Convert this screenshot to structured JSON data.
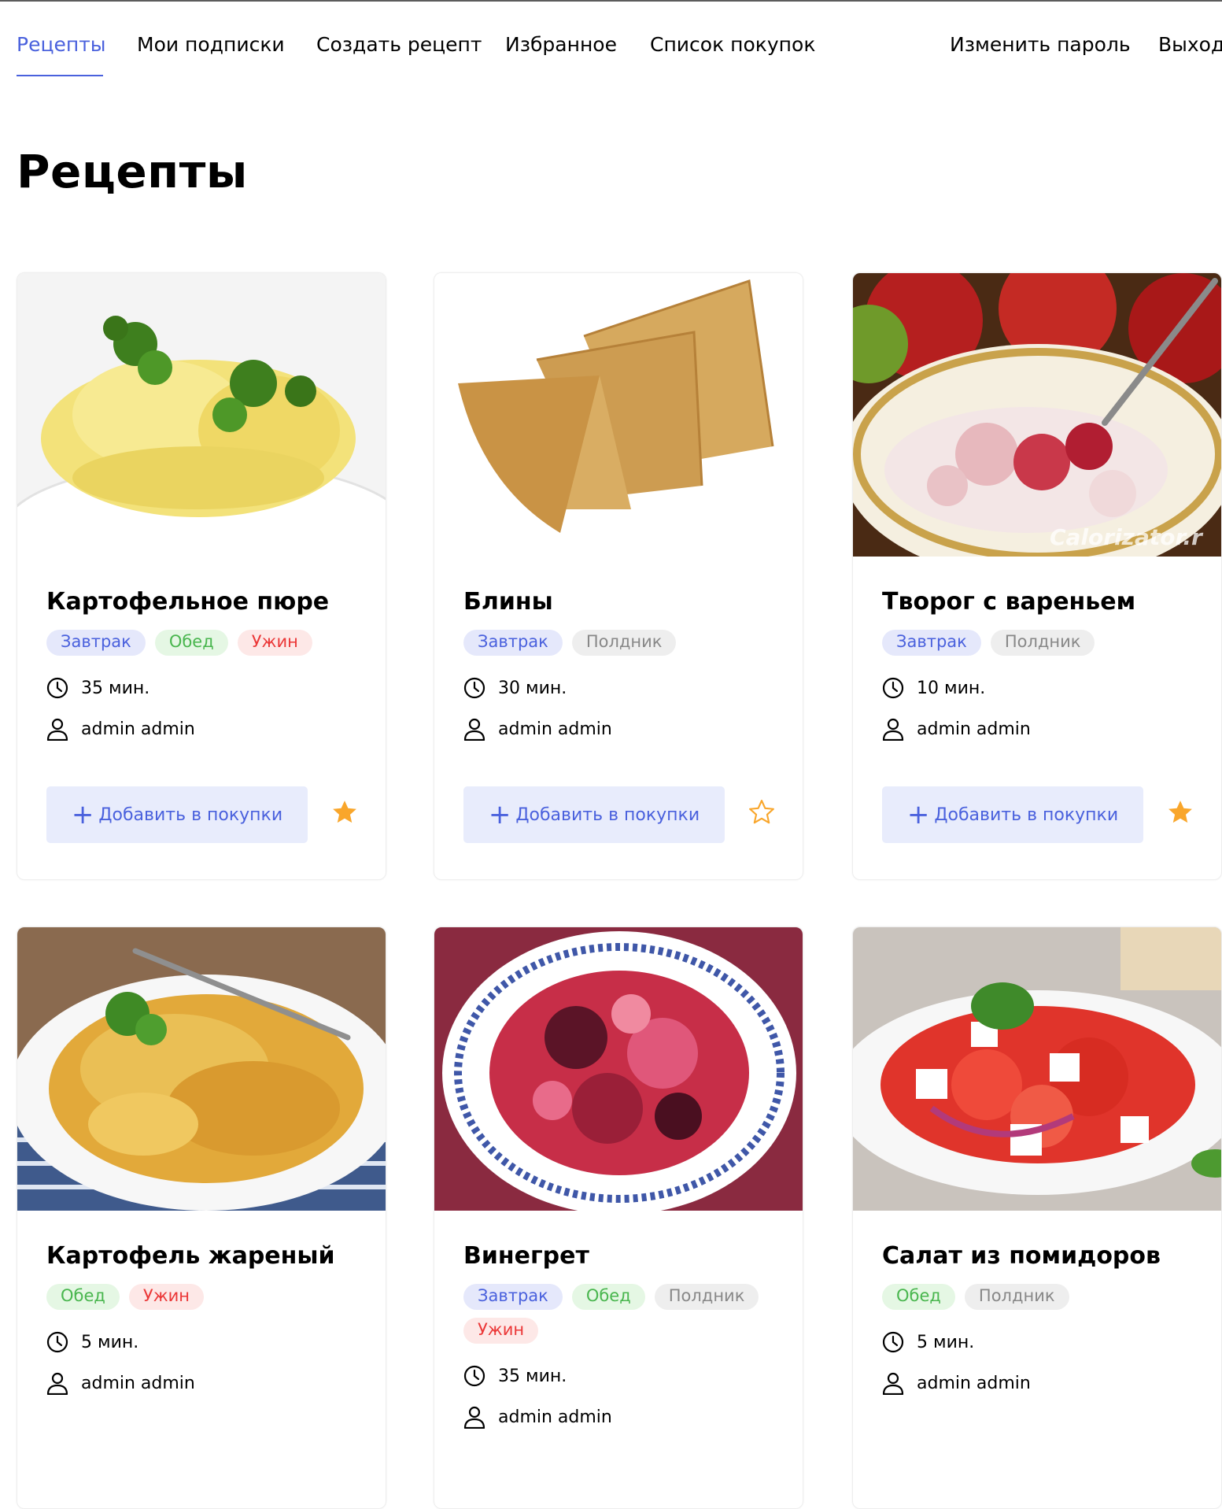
{
  "nav": {
    "links": [
      "Рецепты",
      "Мои подписки",
      "Создать рецепт",
      "Избранное",
      "Список покупок"
    ],
    "right": [
      "Изменить пароль",
      "Выход"
    ],
    "active": "Рецепты"
  },
  "page_title": "Рецепты",
  "colors": {
    "accent": "#4a61dd",
    "star": "#f9a62b"
  },
  "cards": [
    {
      "title": "Картофельное пюре",
      "tags": [
        "Завтрак",
        "Обед",
        "Ужин"
      ],
      "time": "35 мин.",
      "author": "admin admin",
      "add_label": "Добавить в покупки",
      "favorite": true,
      "image": "mashed-potatoes-image"
    },
    {
      "title": "Блины",
      "tags": [
        "Завтрак",
        "Полдник"
      ],
      "time": "30 мин.",
      "author": "admin admin",
      "add_label": "Добавить в покупки",
      "favorite": false,
      "image": "pancakes-image"
    },
    {
      "title": "Творог с вареньем",
      "tags": [
        "Завтрак",
        "Полдник"
      ],
      "time": "10 мин.",
      "author": "admin admin",
      "add_label": "Добавить в покупки",
      "favorite": true,
      "image": "cottage-cheese-jam-image",
      "watermark": "Calorizator.r"
    },
    {
      "title": "Картофель жареный",
      "tags": [
        "Обед",
        "Ужин"
      ],
      "time": "5 мин.",
      "author": "admin admin",
      "image": "fried-potatoes-image"
    },
    {
      "title": "Винегрет",
      "tags": [
        "Завтрак",
        "Обед",
        "Полдник",
        "Ужин"
      ],
      "time": "35 мин.",
      "author": "admin admin",
      "image": "vinaigrette-image"
    },
    {
      "title": "Салат из помидоров",
      "tags": [
        "Обед",
        "Полдник"
      ],
      "time": "5 мин.",
      "author": "admin admin",
      "image": "tomato-salad-image"
    }
  ]
}
